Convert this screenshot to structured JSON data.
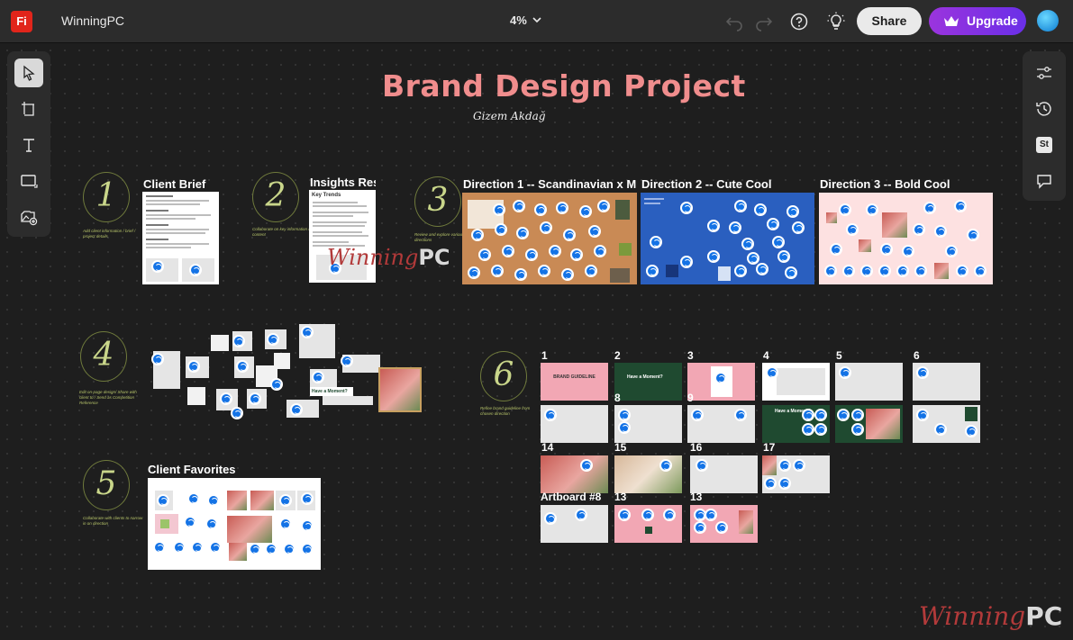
{
  "app": {
    "logo_text": "Fi",
    "title": "WinningPC",
    "zoom": "4%",
    "share_label": "Share",
    "upgrade_label": "Upgrade"
  },
  "colors": {
    "brand": "#e1251b",
    "upgrade": "#8a33e4",
    "title_pink": "#f08d8d",
    "sync_blue": "#1473e6",
    "direction1_bg": "#c98a55",
    "direction2_bg": "#2a5fbf",
    "direction3_bg": "#fde1e1"
  },
  "left_tools": [
    "select-tool",
    "artboard-tool",
    "text-tool",
    "shape-tool",
    "image-tool"
  ],
  "right_tools": [
    "properties-icon",
    "history-icon",
    "stock-icon",
    "comments-icon"
  ],
  "stock_badge": "St",
  "board": {
    "title": "Brand Design Project",
    "author": "Gizem Akdağ"
  },
  "steps": [
    {
      "num": "1",
      "note": "Add client information / brief / project details"
    },
    {
      "num": "2",
      "note": "Collaborate on key information / content"
    },
    {
      "num": "3",
      "note": "Review and explore various directions"
    },
    {
      "num": "4",
      "note": "Edit on-page design/ Share with client to / Send as Competition Reference"
    },
    {
      "num": "5",
      "note": "Collaborate with clients to narrow in on direction"
    },
    {
      "num": "6",
      "note": "Refine brand guideline from chosen direction"
    }
  ],
  "sections": {
    "client_brief": "Client Brief",
    "insights": "Insights Rese",
    "insights_heading": "Key Trends",
    "direction1": "Direction 1 -- Scandinavian x Mini",
    "direction2": "Direction 2 -- Cute Cool",
    "direction3": "Direction 3 -- Bold Cool",
    "client_favorites": "Client Favorites",
    "moment_chip": "Have a Moment?"
  },
  "artboards": {
    "row1": [
      "1",
      "2",
      "3",
      "4",
      "5",
      "6"
    ],
    "row2": [
      "8",
      "9"
    ],
    "row3": [
      "14",
      "15",
      "16",
      "17"
    ],
    "row4": [
      "Artboard #8",
      "13",
      "13"
    ],
    "brand_guideline": "BRAND GUIDELINE",
    "have_moment": "Have a Moment?",
    "have_moment_small": "Have a Moment?"
  },
  "watermark": {
    "winning": "Winning",
    "pc": "PC"
  }
}
